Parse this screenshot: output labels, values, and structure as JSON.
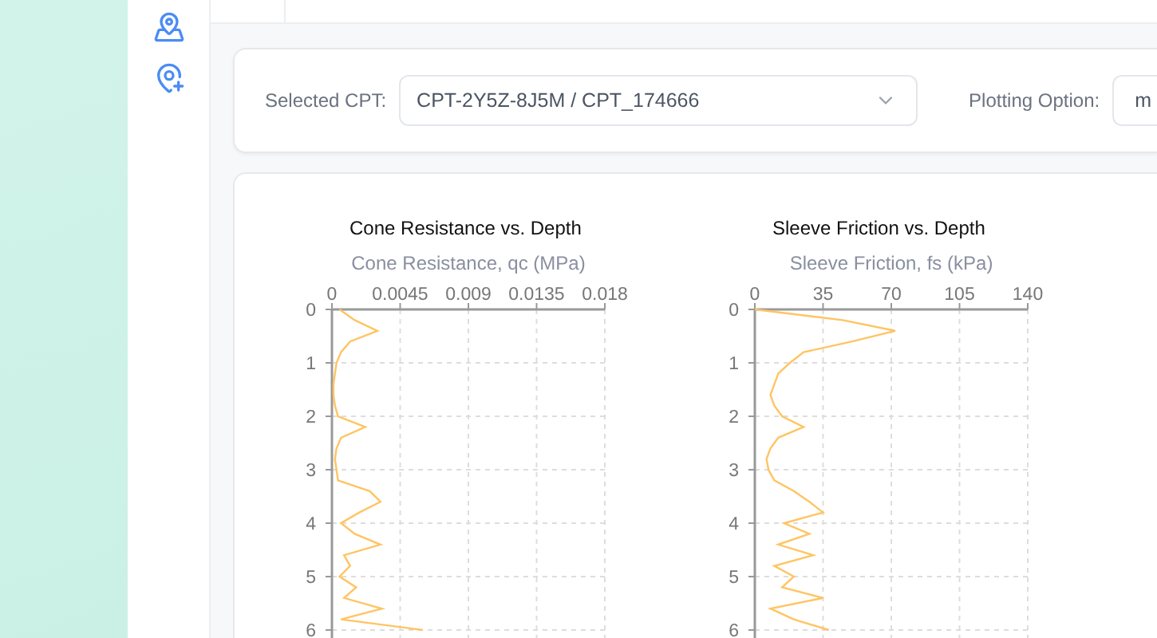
{
  "filters": {
    "selected_cpt": {
      "label": "Selected CPT:",
      "value": "CPT-2Y5Z-8J5M / CPT_174666"
    },
    "plotting_option": {
      "label": "Plotting Option:",
      "value": "m"
    }
  },
  "charts": [
    {
      "chart_data": {
        "type": "line",
        "orientation": "horizontal",
        "title": "Cone Resistance vs. Depth",
        "xlabel": "Cone Resistance, qc (MPa)",
        "xlim": [
          0,
          0.018
        ],
        "grid": true,
        "xticks": [
          0,
          0.0045,
          0.009,
          0.0135,
          0.018
        ],
        "ylim": [
          6,
          0
        ],
        "yticks": [
          0,
          1,
          2,
          3,
          4,
          5,
          6
        ],
        "x": [
          0,
          0.2,
          0.4,
          0.6,
          0.8,
          1,
          1.2,
          1.4,
          1.6,
          1.8,
          2,
          2.2,
          2.4,
          2.6,
          2.8,
          3,
          3.2,
          3.4,
          3.6,
          3.8,
          4,
          4.2,
          4.4,
          4.6,
          4.8,
          5,
          5.2,
          5.4,
          5.6,
          5.8,
          6
        ],
        "series": [
          {
            "color": "#ffc462",
            "values": [
              0.0005,
              0.0015,
              0.003,
              0.0012,
              0.0006,
              0.0003,
              0.0002,
              0.0001,
              0.0001,
              0.0002,
              0.0004,
              0.0022,
              0.0006,
              0.0003,
              0.0002,
              0.0003,
              0.0004,
              0.0025,
              0.0032,
              0.0018,
              0.0006,
              0.0015,
              0.0032,
              0.0008,
              0.0012,
              0.0005,
              0.0016,
              0.0008,
              0.0033,
              0.0006,
              0.006
            ]
          }
        ]
      }
    },
    {
      "chart_data": {
        "type": "line",
        "orientation": "horizontal",
        "title": "Sleeve Friction vs. Depth",
        "xlabel": "Sleeve Friction, fs (kPa)",
        "xlim": [
          0,
          140
        ],
        "grid": true,
        "xticks": [
          0,
          35,
          70,
          105,
          140
        ],
        "ylim": [
          6,
          0
        ],
        "yticks": [
          0,
          1,
          2,
          3,
          4,
          5,
          6
        ],
        "x": [
          0,
          0.2,
          0.4,
          0.6,
          0.8,
          1,
          1.2,
          1.4,
          1.6,
          1.8,
          2,
          2.2,
          2.4,
          2.6,
          2.8,
          3,
          3.2,
          3.4,
          3.6,
          3.8,
          4,
          4.2,
          4.4,
          4.6,
          4.8,
          5,
          5.2,
          5.4,
          5.6,
          5.8,
          6
        ],
        "series": [
          {
            "color": "#ffc462",
            "values": [
              0,
              45,
              72,
              50,
              25,
              18,
              12,
              10,
              8,
              10,
              14,
              25,
              12,
              8,
              6,
              7,
              10,
              20,
              28,
              35,
              15,
              28,
              12,
              30,
              10,
              20,
              14,
              35,
              8,
              20,
              38
            ]
          }
        ]
      }
    }
  ]
}
